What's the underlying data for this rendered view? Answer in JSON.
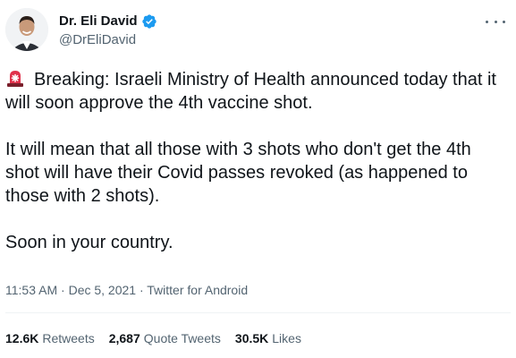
{
  "author": {
    "display_name": "Dr. Eli David",
    "handle": "@DrEliDavid",
    "verified": true
  },
  "tweet": {
    "paragraphs": [
      "Breaking: Israeli Ministry of Health announced today that it will soon approve the 4th vaccine shot.",
      "It will mean that all those with 3 shots who don't get the 4th shot will have their Covid passes revoked (as happened to those with 2 shots).",
      "Soon in your country."
    ],
    "leading_icon": "siren-icon"
  },
  "meta": {
    "time": "11:53 AM",
    "date": "Dec 5, 2021",
    "source": "Twitter for Android",
    "separator": "·"
  },
  "stats": {
    "retweets_count": "12.6K",
    "retweets_label": "Retweets",
    "quotes_count": "2,687",
    "quotes_label": "Quote Tweets",
    "likes_count": "30.5K",
    "likes_label": "Likes"
  },
  "colors": {
    "text_primary": "#0f1419",
    "text_secondary": "#536471",
    "verified_blue": "#1d9bf0",
    "siren_red": "#e0314b"
  }
}
